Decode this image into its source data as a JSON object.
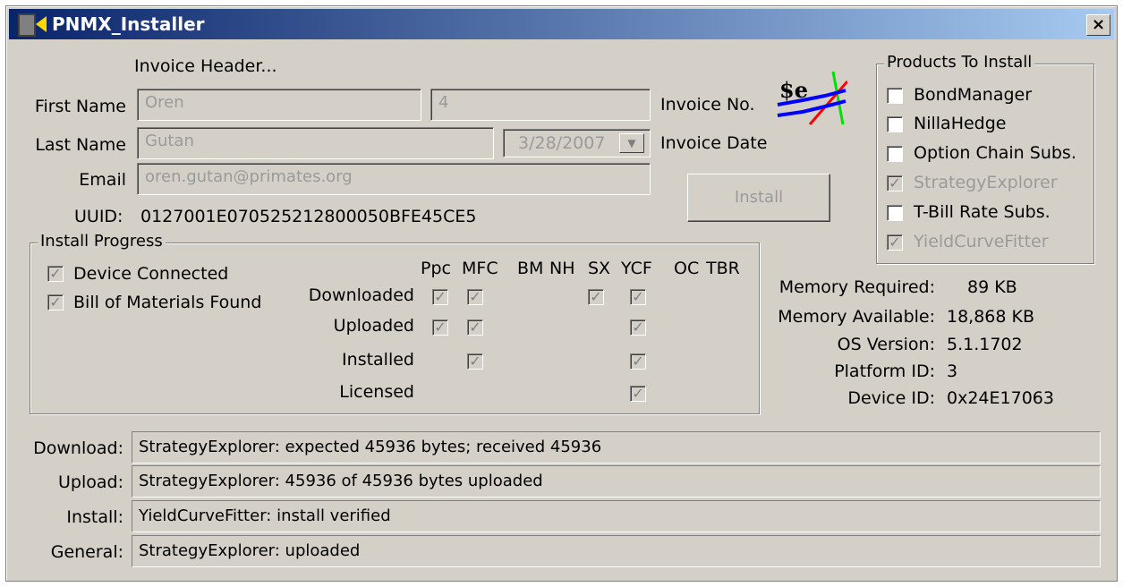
{
  "window": {
    "title": "PNMX_Installer",
    "close_glyph": "×"
  },
  "invoice": {
    "header": "Invoice Header...",
    "first_name_label": "First Name",
    "first_name": "Oren",
    "invoice_no_value": "4",
    "invoice_no_label": "Invoice No.",
    "last_name_label": "Last Name",
    "last_name": "Gutan",
    "date": "3/28/2007",
    "date_label": "Invoice Date",
    "email_label": "Email",
    "email": "oren.gutan@primates.org",
    "uuid_label": "UUID:",
    "uuid": "0127001E070525212800050BFE45CE5"
  },
  "install_button": "Install",
  "logo": {
    "icon": "strategy-explorer-logo-icon",
    "text": "$e"
  },
  "products": {
    "title": "Products To Install",
    "items": [
      {
        "label": "BondManager",
        "checked": false,
        "disabled": false
      },
      {
        "label": "NillaHedge",
        "checked": false,
        "disabled": false
      },
      {
        "label": "Option Chain Subs.",
        "checked": false,
        "disabled": false
      },
      {
        "label": "StrategyExplorer",
        "checked": true,
        "disabled": true
      },
      {
        "label": "T-Bill Rate Subs.",
        "checked": false,
        "disabled": false
      },
      {
        "label": "YieldCurveFitter",
        "checked": true,
        "disabled": true
      }
    ]
  },
  "progress": {
    "title": "Install Progress",
    "device_connected": "Device Connected",
    "bom_found": "Bill of Materials Found",
    "columns": [
      "Ppc",
      "MFC",
      "BM",
      "NH",
      "SX",
      "YCF",
      "OC",
      "TBR"
    ],
    "rows": [
      "Downloaded",
      "Uploaded",
      "Installed",
      "Licensed"
    ]
  },
  "sysinfo": {
    "mem_req_label": "Memory Required:",
    "mem_req": "89 KB",
    "mem_avail_label": "Memory Available:",
    "mem_avail": "18,868 KB",
    "os_label": "OS Version:",
    "os": "5.1.1702",
    "platform_label": "Platform ID:",
    "platform": "3",
    "device_label": "Device ID:",
    "device": "0x24E17063"
  },
  "status": {
    "download_label": "Download:",
    "download": "StrategyExplorer: expected 45936 bytes; received 45936",
    "upload_label": "Upload:",
    "upload": "StrategyExplorer: 45936 of 45936 bytes uploaded",
    "install_label": "Install:",
    "install": "YieldCurveFitter: install verified",
    "general_label": "General:",
    "general": "StrategyExplorer: uploaded"
  },
  "check_glyph": "✓"
}
